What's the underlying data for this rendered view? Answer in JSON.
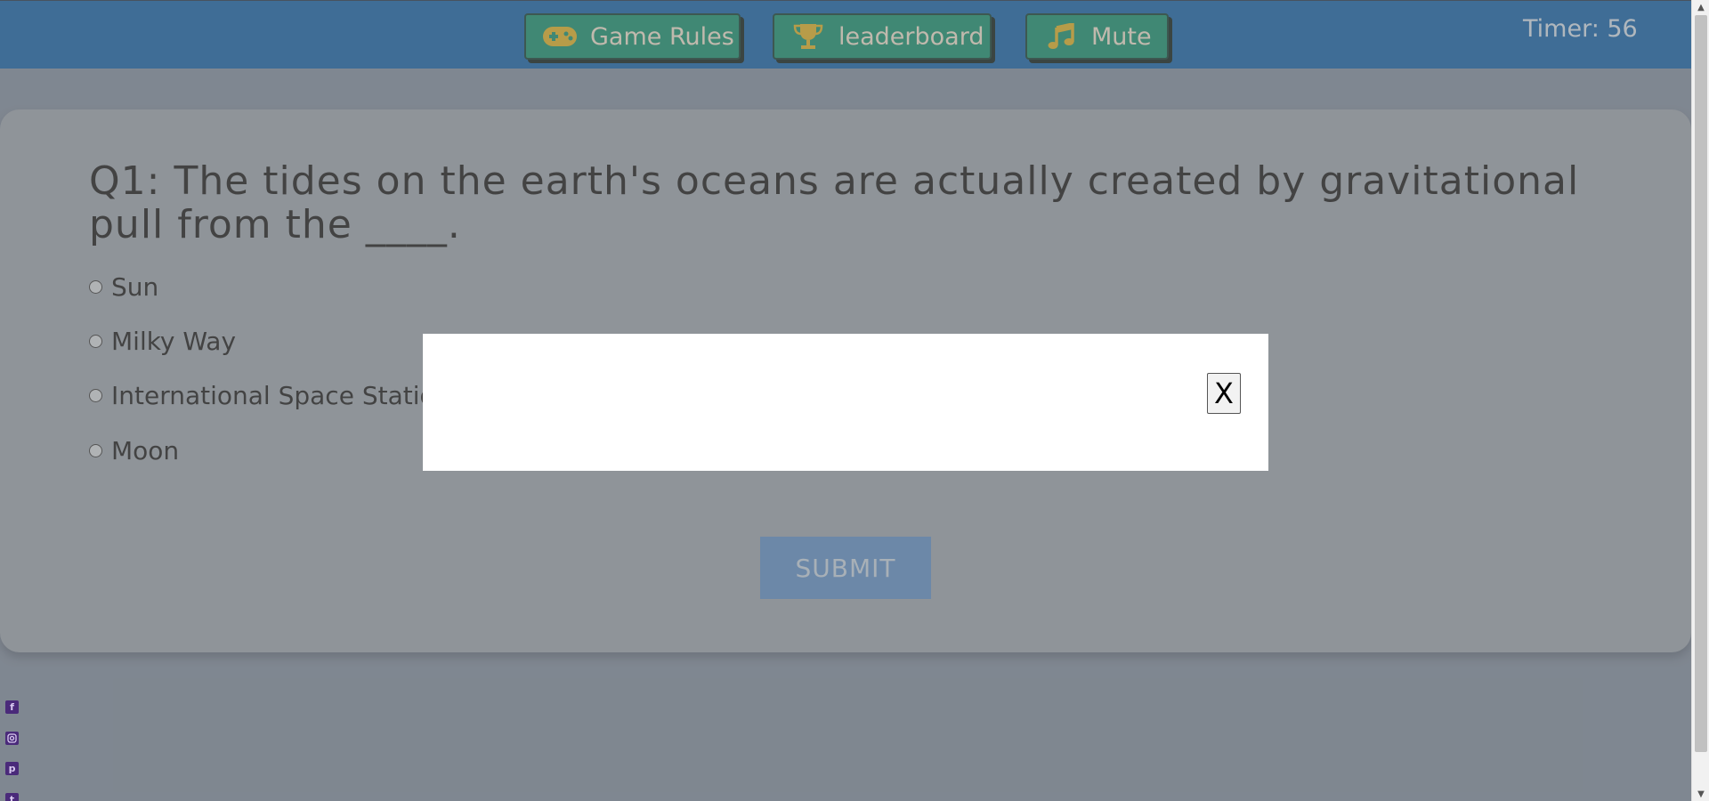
{
  "header": {
    "rules_label": "Game Rules",
    "leaderboard_label": "leaderboard",
    "mute_label": "Mute",
    "timer_text": "Timer: 56",
    "icons": [
      "gamepad-icon",
      "trophy-icon",
      "music-note-icon"
    ]
  },
  "quiz": {
    "question": "Q1: The tides on the earth's oceans are actually created by gravitational pull from the ____.",
    "options": [
      {
        "label": "Sun"
      },
      {
        "label": "Milky Way"
      },
      {
        "label": "International Space Station"
      },
      {
        "label": "Moon"
      }
    ],
    "submit_label": "SUBMIT"
  },
  "modal": {
    "close_label": "X"
  },
  "social": {
    "icons": [
      "facebook-icon",
      "instagram-icon",
      "pinterest-icon",
      "twitter-icon"
    ]
  },
  "colors": {
    "header_bg": "#0a5ea8",
    "nav_button_bg": "#0b8f6a",
    "nav_icon": "#e3b21c",
    "submit_bg": "#5b8fc8",
    "social_icon": "#4a2a7a"
  }
}
